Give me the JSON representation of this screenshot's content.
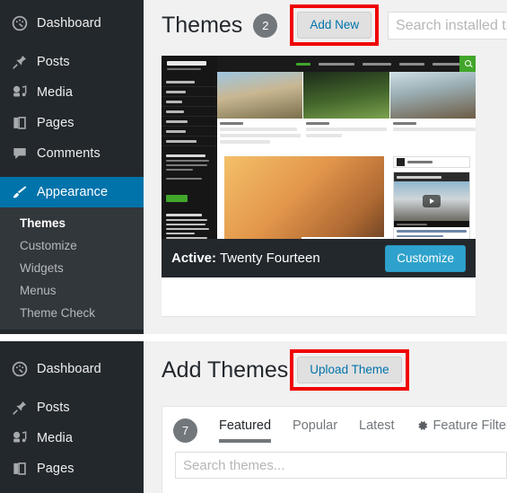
{
  "panels": {
    "top": {
      "sidebar": {
        "items": [
          {
            "id": "dashboard",
            "label": "Dashboard",
            "icon": "dashboard-icon"
          },
          {
            "id": "posts",
            "label": "Posts",
            "icon": "pin-icon"
          },
          {
            "id": "media",
            "label": "Media",
            "icon": "media-icon"
          },
          {
            "id": "pages",
            "label": "Pages",
            "icon": "pages-icon"
          },
          {
            "id": "comments",
            "label": "Comments",
            "icon": "comment-icon"
          },
          {
            "id": "appearance",
            "label": "Appearance",
            "icon": "brush-icon"
          }
        ],
        "submenu": [
          {
            "label": "Themes",
            "current": true
          },
          {
            "label": "Customize",
            "current": false
          },
          {
            "label": "Widgets",
            "current": false
          },
          {
            "label": "Menus",
            "current": false
          },
          {
            "label": "Theme Check",
            "current": false
          }
        ]
      },
      "header": {
        "title": "Themes",
        "count": "2",
        "add_new_label": "Add New",
        "search_placeholder": "Search installed themes..."
      },
      "theme_card": {
        "active_prefix": "Active:",
        "active_theme": "Twenty Fourteen",
        "customize_label": "Customize",
        "screenshot": {
          "site_title": "Twenty Fourteen",
          "tagline": "A beautiful magazine theme",
          "nav": [
            "HOME",
            "DEMO SETTINGS",
            "POST FORMATS",
            "HTML ELEMENTS",
            "PAGE ELEMENTS AND STYLES"
          ],
          "menu": [
            "POST FORMATS",
            "ARTWORK",
            "BOOKS",
            "MUSIC",
            "PHOTOS",
            "VIDEOS",
            "WORDPRESS"
          ],
          "hero_cards": [
            {
              "kicker": "FEATURED, TRAVEL",
              "title": "A WEEKEND AWAY IN THE COUNTRYSIDE BEFORE THE WEDDING DAY"
            },
            {
              "kicker": "FEATURED, NATURE",
              "title": "THIS IS IT I'M GOING, SEE YOU ALL NEXT SUMMER"
            },
            {
              "kicker": "FEATURED, TRAVEL",
              "title": "MEMORIES FROM THE LAST SUMMER"
            }
          ],
          "feature_kicker": "PHOTOS",
          "feature_title": "FEATURED IMAGES REALLY",
          "widget_follow_title": "FOLLOW BLOG VIA EMAIL",
          "widget_follow_button": "FOLLOW",
          "widget_popular_title": "TOP POSTS & PAGES",
          "video_widget_title": "VIDEOS",
          "video_item_title": "Sam reads HD Time Lapse video"
        }
      }
    },
    "bottom": {
      "sidebar": {
        "items": [
          {
            "id": "dashboard",
            "label": "Dashboard",
            "icon": "dashboard-icon"
          },
          {
            "id": "posts",
            "label": "Posts",
            "icon": "pin-icon"
          },
          {
            "id": "media",
            "label": "Media",
            "icon": "media-icon"
          },
          {
            "id": "pages",
            "label": "Pages",
            "icon": "pages-icon"
          }
        ]
      },
      "header": {
        "title": "Add Themes",
        "upload_label": "Upload Theme"
      },
      "filter_bar": {
        "count": "7",
        "tabs": [
          {
            "label": "Featured",
            "active": true,
            "icon": null
          },
          {
            "label": "Popular",
            "active": false,
            "icon": null
          },
          {
            "label": "Latest",
            "active": false,
            "icon": null
          },
          {
            "label": "Feature Filter",
            "active": false,
            "icon": "gear-icon"
          }
        ],
        "search_placeholder": "Search themes..."
      }
    }
  },
  "colors": {
    "sidebar_bg": "#23282d",
    "submenu_bg": "#32373c",
    "accent_blue": "#0073aa",
    "button_blue": "#2ea2cc",
    "highlight_red": "#f00000",
    "content_bg": "#f1f1f1",
    "badge_gray": "#72777c"
  }
}
